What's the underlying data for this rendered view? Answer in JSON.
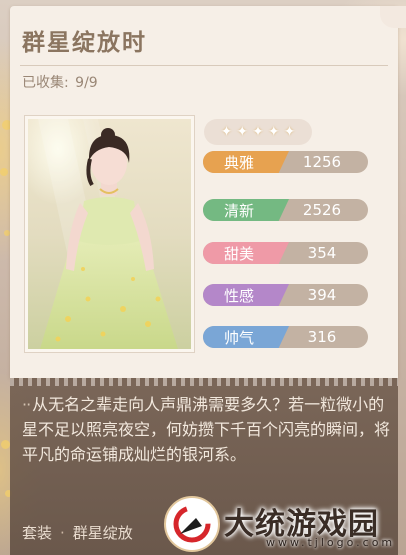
{
  "card": {
    "title": "群星绽放时",
    "collected_label": "已收集:",
    "collected_value": "9/9"
  },
  "rating": {
    "stars": 5,
    "star_glyph": "✦"
  },
  "attributes": [
    {
      "label": "典雅",
      "value": "1256",
      "color": "#e7a250"
    },
    {
      "label": "清新",
      "value": "2526",
      "color": "#74b982"
    },
    {
      "label": "甜美",
      "value": "354",
      "color": "#ef9aa7"
    },
    {
      "label": "性感",
      "value": "394",
      "color": "#b487c9"
    },
    {
      "label": "帅气",
      "value": "316",
      "color": "#7aa6d6"
    }
  ],
  "description": {
    "text": "从无名之辈走向人声鼎沸需要多久？若一粒微小的星不足以照亮夜空，何妨攒下千百个闪亮的瞬间，将平凡的命运铺成灿烂的银河系。",
    "set_label": "套装",
    "set_name": "群星绽放"
  },
  "watermark": {
    "name": "大统游戏园",
    "url": "www.tjlogo.com"
  },
  "colors": {
    "card_bg": "#f6efe7",
    "title": "#8b7560",
    "panel_bg": "#705c4e"
  }
}
